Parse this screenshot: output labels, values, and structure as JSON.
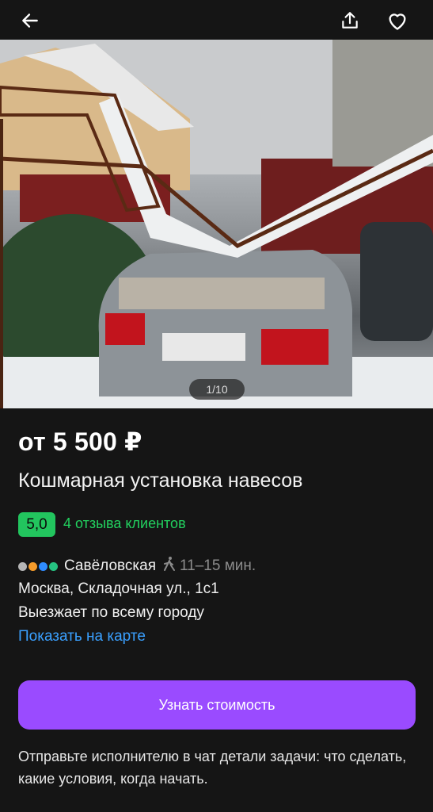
{
  "header": {
    "back_icon": "arrow-left-icon",
    "share_icon": "share-icon",
    "favorite_icon": "heart-icon"
  },
  "gallery": {
    "counter": "1/10"
  },
  "listing": {
    "price": "от 5 500 ₽",
    "title": "Кошмарная установка навесов",
    "rating": "5,0",
    "reviews": "4 отзыва клиентов",
    "metro": {
      "line_colors": [
        "#b5b5b5",
        "#f59b2b",
        "#2f8cff",
        "#26c281"
      ],
      "station": "Савёловская",
      "walk_icon": "walking-person-icon",
      "time": "11–15 мин."
    },
    "address": "Москва, Складочная ул., 1с1",
    "service_area": "Выезжает по всему городу",
    "map_link": "Показать на карте"
  },
  "cta": {
    "label": "Узнать стоимость"
  },
  "hint": "Отправьте исполнителю в чат детали задачи: что сделать, какие условия, когда начать.",
  "colors": {
    "background": "#151515",
    "accent": "#9a4bff",
    "rating_green": "#22c55e",
    "link_blue": "#3aa0ff"
  }
}
